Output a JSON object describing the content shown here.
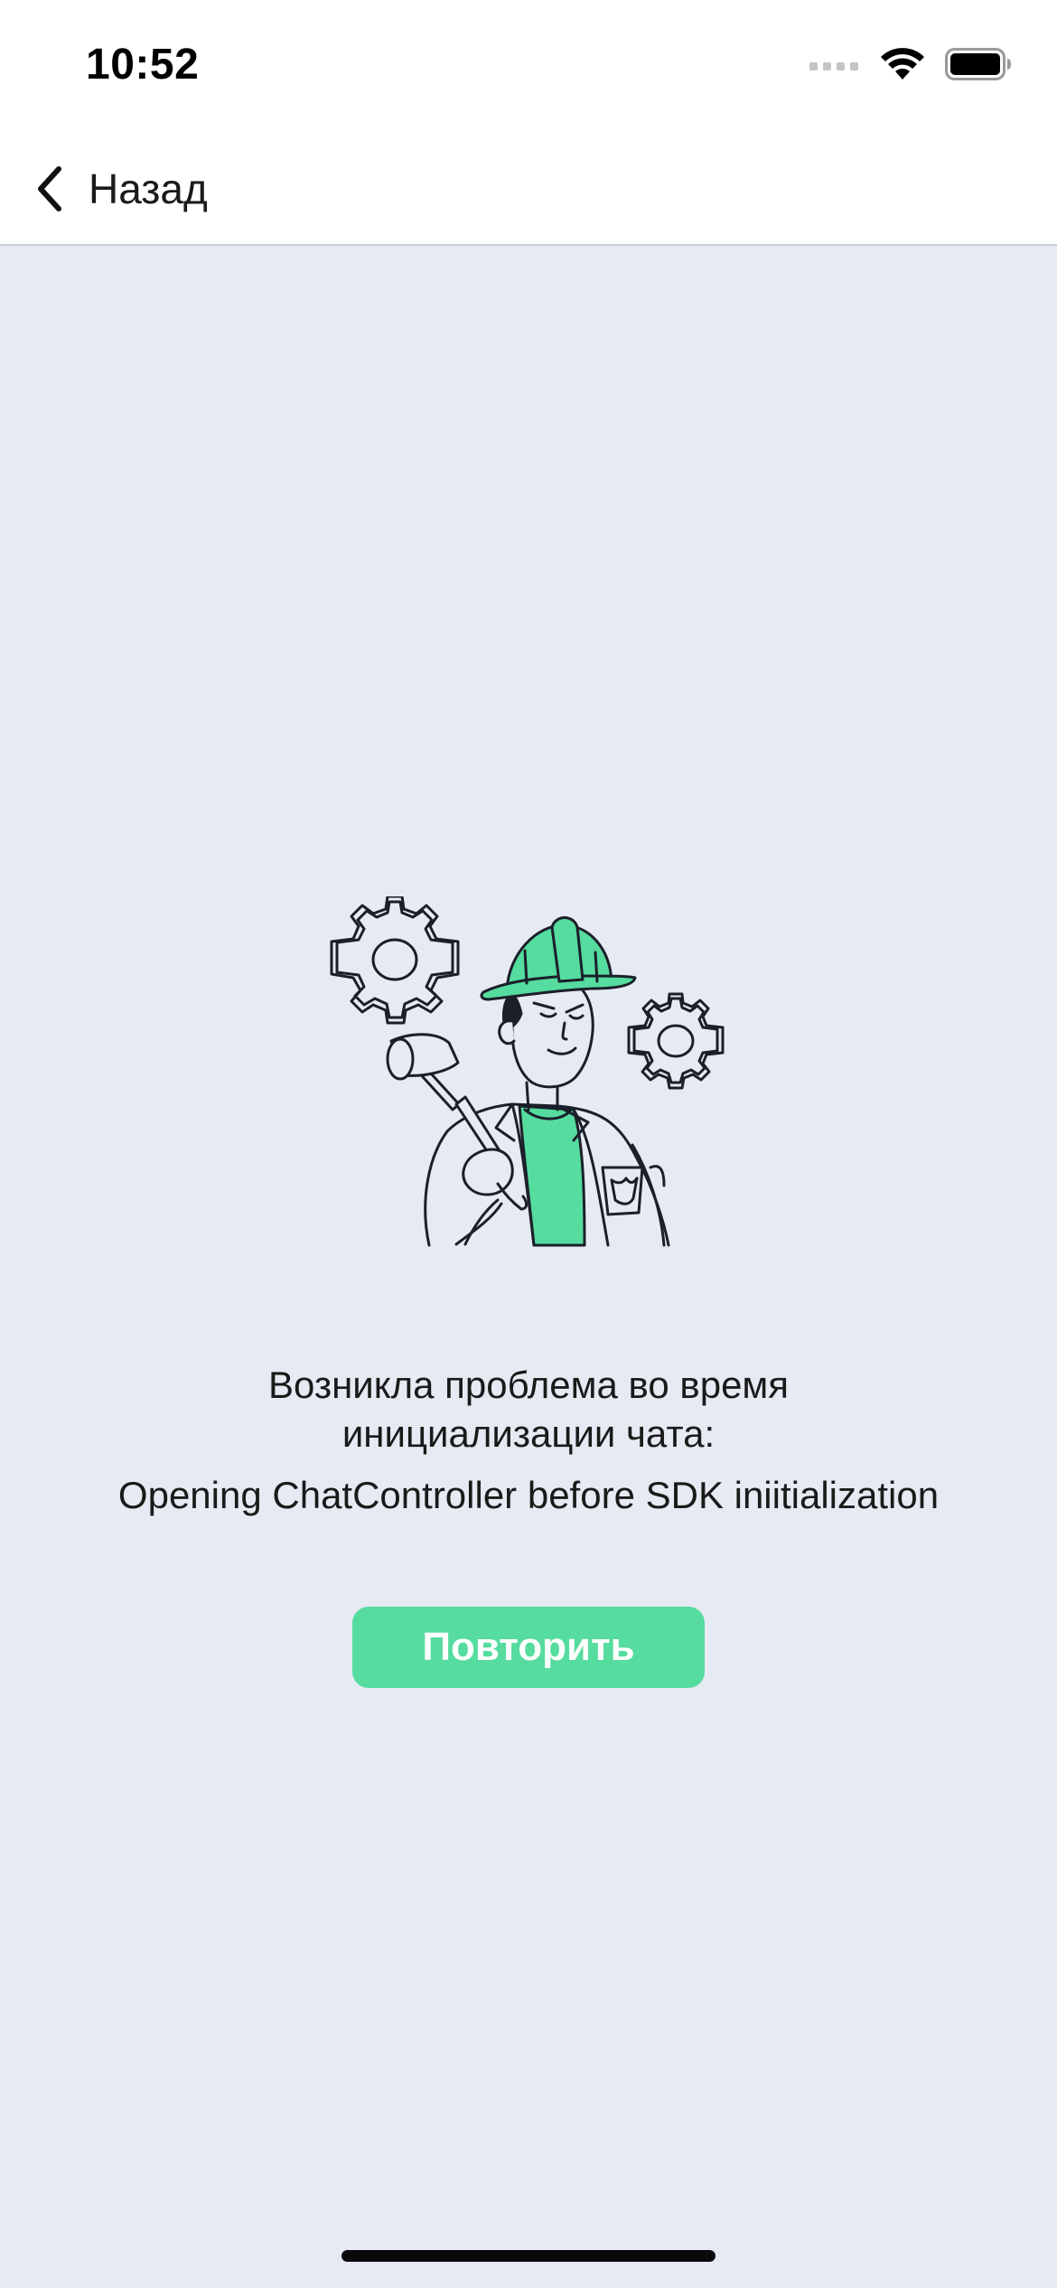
{
  "status_bar": {
    "time": "10:52",
    "icons": [
      "signal-icon",
      "wifi-icon",
      "battery-icon"
    ]
  },
  "nav": {
    "back_label": "Назад",
    "back_icon": "chevron-left-icon"
  },
  "error": {
    "illustration": "engineer-with-hammer-and-gears",
    "line1": "Возникла проблема во время",
    "line2": "инициализации чата:",
    "detail": "Opening ChatController before SDK iniitialization"
  },
  "actions": {
    "retry_label": "Повторить"
  },
  "colors": {
    "background": "#e6eaf3",
    "accent": "#55dc9e",
    "ink": "#1a1a1a"
  }
}
